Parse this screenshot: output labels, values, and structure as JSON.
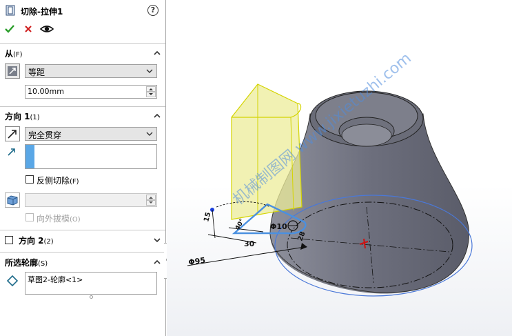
{
  "feature": {
    "title": "切除-拉伸1",
    "help": "?"
  },
  "actions": {
    "ok": "ok-check",
    "cancel": "cancel-x",
    "preview": "preview-eye"
  },
  "from": {
    "title": "从",
    "title_suffix": "(F)",
    "mode": "等距",
    "offset_value": "10.00mm"
  },
  "direction1": {
    "title": "方向 1",
    "title_suffix": "(1)",
    "end_condition": "完全贯穿",
    "flip_cut_label": "反侧切除",
    "flip_cut_suffix": "(F)",
    "flip_cut_checked": false,
    "draft_angle_value": "",
    "draft_outward_label": "向外拔模",
    "draft_outward_suffix": "(O)"
  },
  "direction2": {
    "title": "方向 2",
    "title_suffix": "(2)",
    "checked": false
  },
  "contours": {
    "title": "所选轮廓",
    "title_suffix": "(S)",
    "items": [
      "草图2-轮廓<1>"
    ]
  },
  "graphics": {
    "dim_diameter_95": "Φ95",
    "dim_diameter_10": "Φ10",
    "dim_15": "15",
    "dim_30": "30",
    "dim_28": "28",
    "dim_angle": "40°",
    "watermark": "机械制图网 www.jixietuzhi.com"
  },
  "colors": {
    "accent_blue": "#5aa7e6",
    "ok_green": "#2a9d2a",
    "cancel_red": "#d02020",
    "preview_yellow": "#ecec9a",
    "body_gray": "#7b7d8c"
  }
}
